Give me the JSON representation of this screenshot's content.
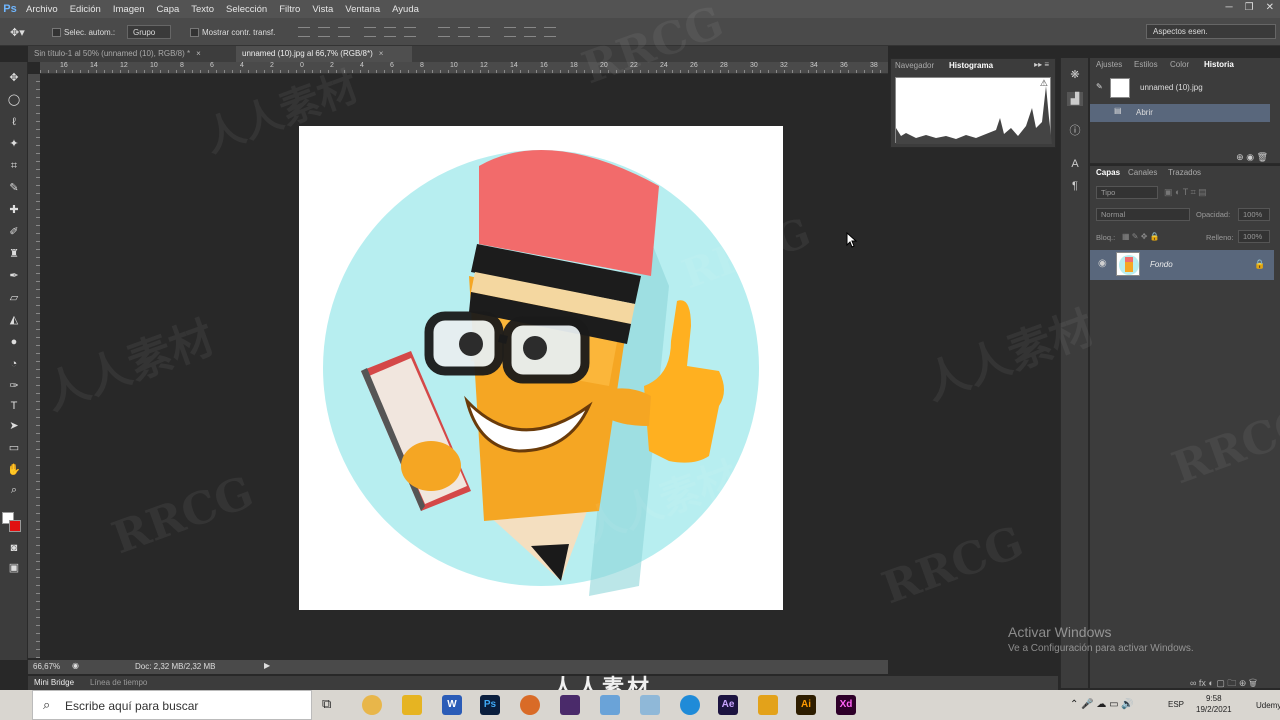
{
  "app": {
    "logo": "Ps"
  },
  "menu": [
    "Archivo",
    "Edición",
    "Imagen",
    "Capa",
    "Texto",
    "Selección",
    "Filtro",
    "Vista",
    "Ventana",
    "Ayuda"
  ],
  "options": {
    "auto_select_label": "Selec. autom.:",
    "group_value": "Grupo",
    "show_transform_label": "Mostrar contr. transf.",
    "workspace_value": "Aspectos esen."
  },
  "tabs": [
    {
      "label": "Sin título-1 al 50% (unnamed (10), RGB/8) *",
      "active": false
    },
    {
      "label": "unnamed (10).jpg al 66,7% (RGB/8*)",
      "active": true
    }
  ],
  "ruler_ticks": [
    "16",
    "14",
    "12",
    "10",
    "8",
    "6",
    "4",
    "2",
    "0",
    "2",
    "4",
    "6",
    "8",
    "10",
    "12",
    "14",
    "16",
    "18",
    "20",
    "22",
    "24",
    "26",
    "28",
    "30",
    "32",
    "34",
    "36",
    "38"
  ],
  "status": {
    "zoom": "66,67%",
    "doc": "Doc: 2,32 MB/2,32 MB"
  },
  "mini_bridge": {
    "tab1": "Mini Bridge",
    "tab2": "Línea de tiempo"
  },
  "nav_panel": {
    "tab_navigator": "Navegador",
    "tab_histogram": "Histograma"
  },
  "history_panel": {
    "tabs": [
      "Ajustes",
      "Estilos",
      "Color",
      "Historia"
    ],
    "snapshot": "unnamed (10).jpg",
    "step": "Abrir"
  },
  "layers_panel": {
    "tabs": [
      "Capas",
      "Canales",
      "Trazados"
    ],
    "kind_filter": "Tipo",
    "blend_mode": "Normal",
    "opacity_label": "Opacidad:",
    "opacity_value": "100%",
    "lock_label": "Bloq.:",
    "fill_label": "Relleno:",
    "fill_value": "100%",
    "layer_name": "Fondo"
  },
  "watermark": {
    "text1": "RRCG",
    "text2": "人人素材"
  },
  "activate_windows": {
    "title": "Activar Windows",
    "subtitle": "Ve a Configuración para activar Windows."
  },
  "taskbar": {
    "search_placeholder": "Escribe aquí para buscar",
    "apps": [
      "Ps",
      "Ae",
      "Ai",
      "Xd"
    ],
    "lang": "ESP",
    "time": "9:58",
    "date": "19/2/2021",
    "tray_text": "Udemy"
  },
  "bottom_logo": "人人素材",
  "colors": {
    "accent": "#59677c",
    "fg": "#ffffff",
    "bg": "#e01010"
  }
}
